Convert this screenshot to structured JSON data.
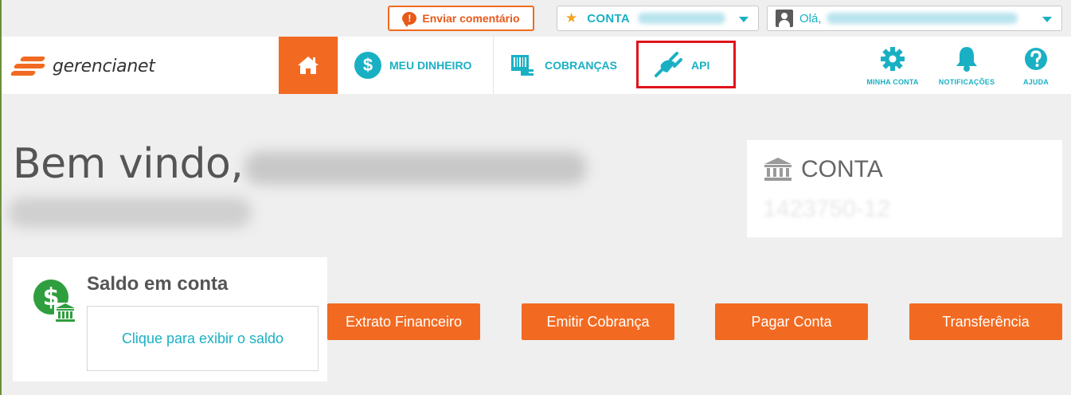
{
  "topbar": {
    "feedback_label": "Enviar comentário",
    "conta_label": "CONTA",
    "greeting": "Olá,"
  },
  "brand": {
    "name": "gerencianet"
  },
  "nav": {
    "meu_dinheiro": "MEU DINHEIRO",
    "cobrancas": "COBRANÇAS",
    "api": "API",
    "minha_conta": "MINHA CONTA",
    "notificacoes": "NOTIFICAÇÕES",
    "ajuda": "AJUDA"
  },
  "welcome": {
    "text": "Bem vindo,"
  },
  "conta_card": {
    "title": "CONTA",
    "account_number": "1423750-12"
  },
  "saldo": {
    "title": "Saldo em conta",
    "reveal_label": "Clique para exibir o saldo"
  },
  "actions": [
    {
      "label": "Extrato Financeiro"
    },
    {
      "label": "Emitir Cobrança"
    },
    {
      "label": "Pagar Conta"
    },
    {
      "label": "Transferência"
    }
  ],
  "colors": {
    "brand_orange": "#f26a21",
    "brand_teal": "#1ab0c4",
    "highlight_red": "#e0141c"
  }
}
